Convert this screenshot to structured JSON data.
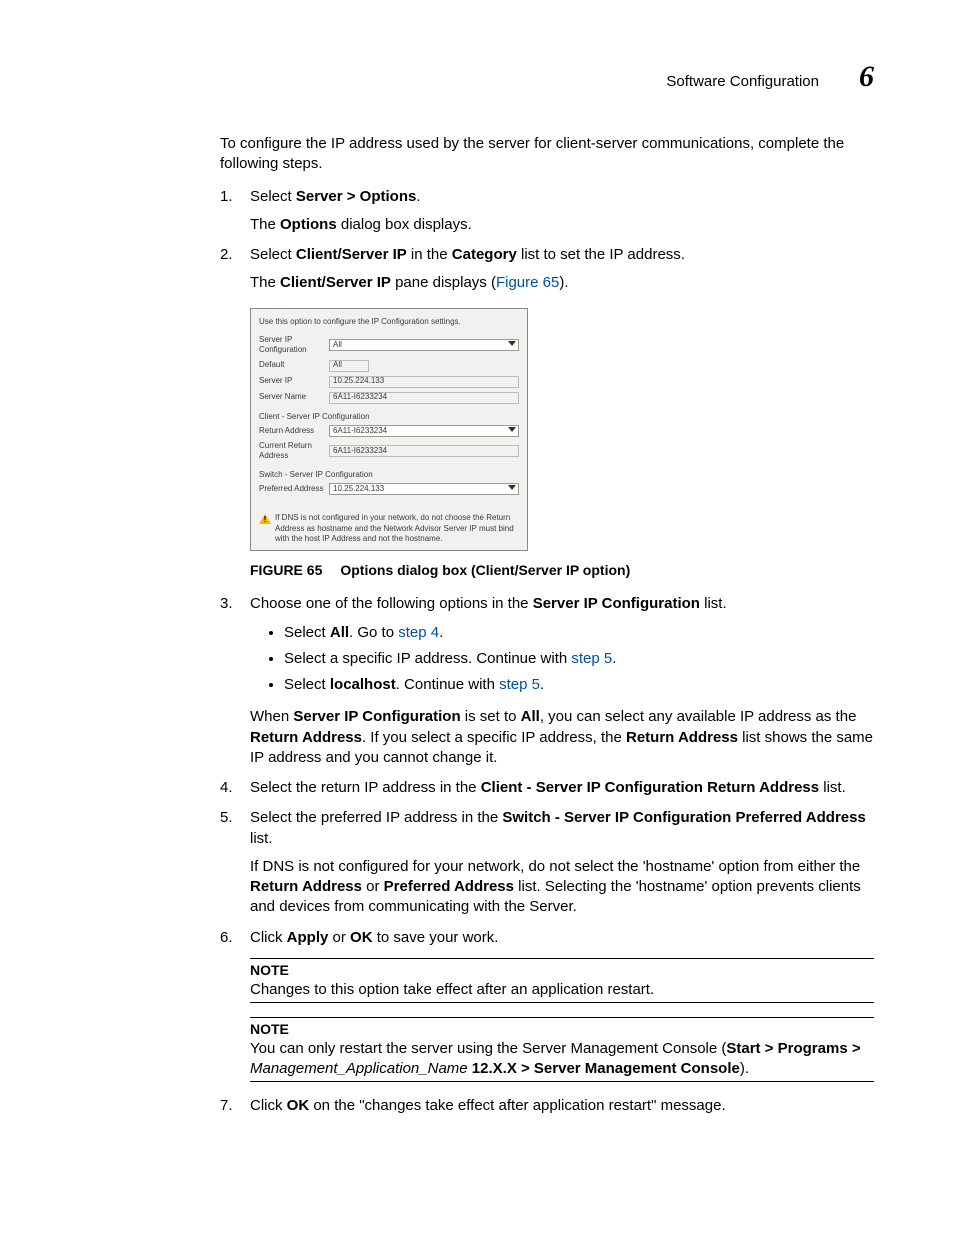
{
  "header": {
    "section": "Software Configuration",
    "chapter": "6"
  },
  "intro": "To configure the IP address used by the server for client-server communications, complete the following steps.",
  "steps": {
    "s1": {
      "pre": "Select ",
      "bold": "Server > Options",
      "post": ".",
      "sub_pre": "The ",
      "sub_bold": "Options",
      "sub_post": " dialog box displays."
    },
    "s2": {
      "pre": "Select ",
      "bold1": "Client/Server IP",
      "mid": " in the ",
      "bold2": "Category",
      "post": " list to set the IP address.",
      "sub_pre": "The ",
      "sub_bold": "Client/Server IP",
      "sub_mid": " pane displays (",
      "link": "Figure 65",
      "sub_post": ")."
    },
    "s3": {
      "pre": "Choose one of the following options in the ",
      "bold": "Server IP Configuration",
      "post": " list.",
      "b1": {
        "pre": "Select ",
        "bold": "All",
        "mid": ". Go to ",
        "link": "step 4",
        "post": "."
      },
      "b2": {
        "pre": "Select a specific IP address. Continue with ",
        "link": "step 5",
        "post": "."
      },
      "b3": {
        "pre": "Select ",
        "bold": "localhost",
        "mid": ". Continue with ",
        "link": "step 5",
        "post": "."
      },
      "para": {
        "pre": "When ",
        "b1": "Server IP Configuration",
        "mid1": " is set to ",
        "b2": "All",
        "mid2": ", you can select any available IP address as the ",
        "b3": "Return Address",
        "mid3": ". If you select a specific IP address, the ",
        "b4": "Return Address",
        "post": " list shows the same IP address and you cannot change it."
      }
    },
    "s4": {
      "pre": "Select the return IP address in the ",
      "bold": "Client - Server IP Configuration Return Address",
      "post": " list."
    },
    "s5": {
      "pre": "Select the preferred IP address in the ",
      "bold": "Switch - Server IP Configuration Preferred Address",
      "post": " list.",
      "para": {
        "pre": "If DNS is not configured for your network, do not select the 'hostname' option from either the ",
        "b1": "Return Address",
        "mid": " or ",
        "b2": "Preferred Address",
        "post": " list. Selecting the 'hostname' option prevents clients and devices from communicating with the Server."
      }
    },
    "s6": {
      "pre": "Click ",
      "b1": "Apply",
      "mid": " or ",
      "b2": "OK",
      "post": " to save your work."
    },
    "s7": {
      "pre": "Click ",
      "b1": "OK",
      "post": " on the \"changes take effect after application restart\" message."
    }
  },
  "notes": {
    "label": "NOTE",
    "n1": "Changes to this option take effect after an application restart.",
    "n2": {
      "pre": "You can only restart the server using the Server Management Console (",
      "b1": "Start > Programs > ",
      "ital": "Management_Application_Name",
      "b2": " 12.X.X > Server Management Console",
      "post": ")."
    }
  },
  "figure": {
    "num": "FIGURE 65",
    "caption": "Options dialog box (Client/Server IP option)",
    "dlg": {
      "intro": "Use this option to configure the IP Configuration settings.",
      "rows": {
        "server_ip_cfg": {
          "label": "Server IP Configuration",
          "value": "All"
        },
        "default": {
          "label": "Default",
          "value": "All"
        },
        "server_ip": {
          "label": "Server IP",
          "value": "10.25.224.133"
        },
        "server_name": {
          "label": "Server Name",
          "value": "6A11-I6233234"
        }
      },
      "sect1": "Client - Server IP Configuration",
      "rows2": {
        "return_addr": {
          "label": "Return Address",
          "value": "6A11-I6233234"
        },
        "cur_return": {
          "label": "Current Return Address",
          "value": "6A11-I6233234"
        }
      },
      "sect2": "Switch - Server IP Configuration",
      "rows3": {
        "pref_addr": {
          "label": "Preferred Address",
          "value": "10.25.224.133"
        }
      },
      "warn": "If DNS is not configured in your network, do not choose the Return Address as hostname and the Network Advisor Server IP must bind with the host IP Address and not the hostname."
    }
  }
}
